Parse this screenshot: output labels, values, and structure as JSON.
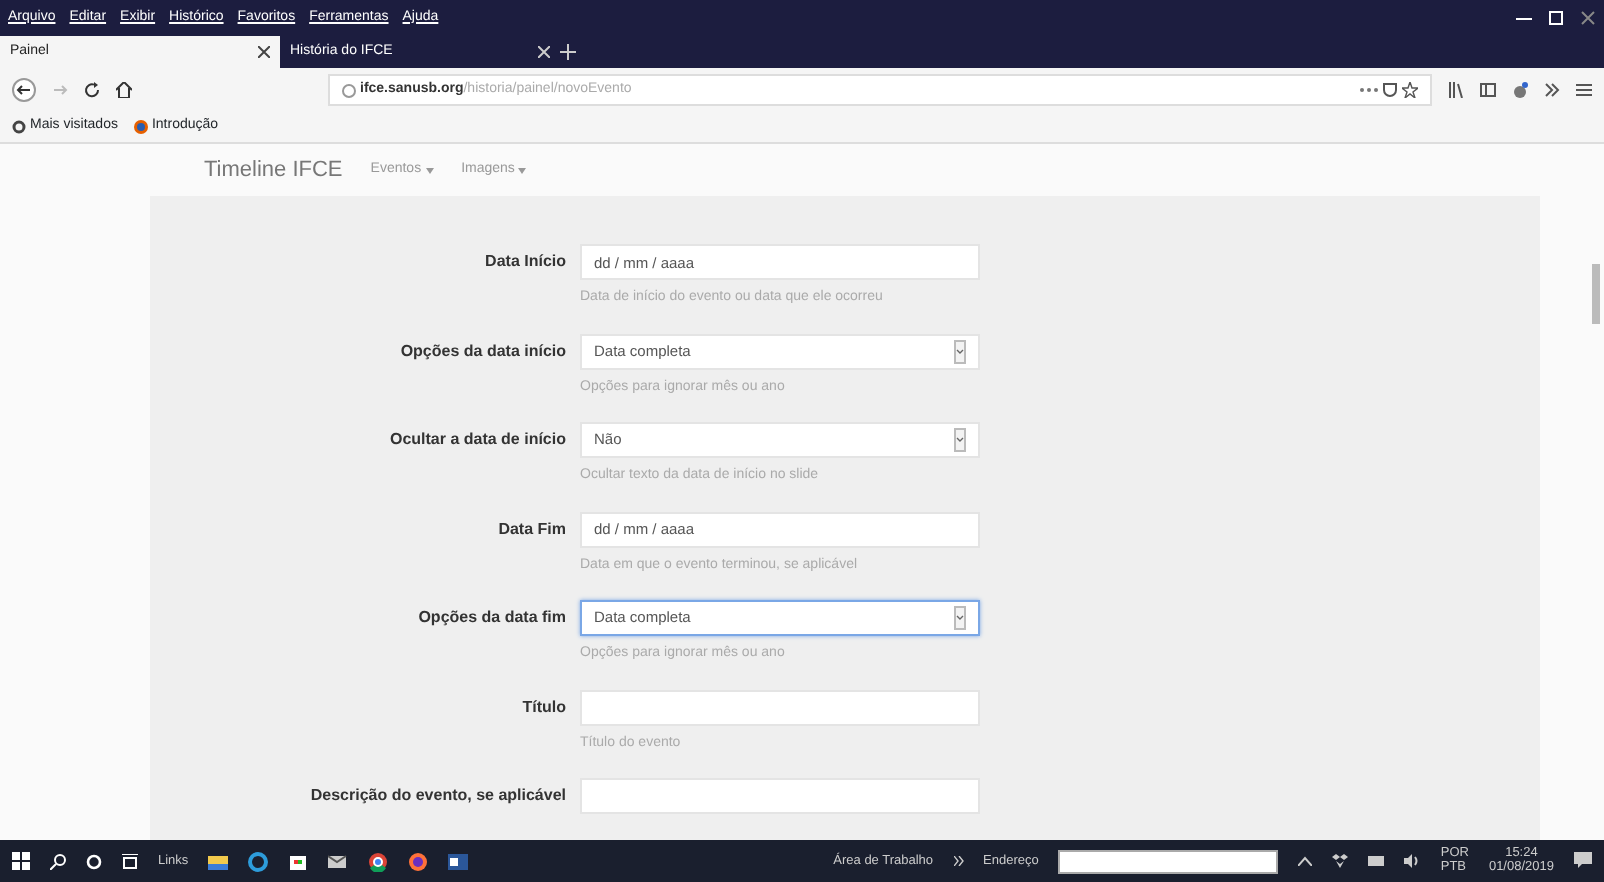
{
  "browser": {
    "menu": [
      "Arquivo",
      "Editar",
      "Exibir",
      "Histórico",
      "Favoritos",
      "Ferramentas",
      "Ajuda"
    ],
    "tabs": [
      {
        "title": "Painel",
        "selected": true
      },
      {
        "title": "História do IFCE",
        "selected": false
      }
    ],
    "address": {
      "domain": "ifce.sanusb.org",
      "path": "/historia/painel/novoEvento"
    },
    "bookmarks": [
      "Mais visitados",
      "Introdução"
    ]
  },
  "site": {
    "brand": "Timeline IFCE",
    "menus": [
      "Eventos",
      "Imagens"
    ]
  },
  "form": [
    {
      "label": "Data Início",
      "kind": "date",
      "value": "dd / mm / aaaa",
      "help": "Data de início do evento ou data que ele ocorreu",
      "focused": false
    },
    {
      "label": "Opções da data início",
      "kind": "select",
      "value": "Data completa",
      "help": "Opções para ignorar mês ou ano",
      "focused": false
    },
    {
      "label": "Ocultar a data de início",
      "kind": "select",
      "value": "Não",
      "help": "Ocultar texto da data de início no slide",
      "focused": false
    },
    {
      "label": "Data Fim",
      "kind": "date",
      "value": "dd / mm / aaaa",
      "help": "Data em que o evento terminou, se aplicável",
      "focused": false
    },
    {
      "label": "Opções da data fim",
      "kind": "select",
      "value": "Data completa",
      "help": "Opções para ignorar mês ou ano",
      "focused": true
    },
    {
      "label": "Título",
      "kind": "text",
      "help": "Título do evento",
      "focused": false
    },
    {
      "label": "Descrição do evento, se aplicável",
      "kind": "text",
      "focused": false
    }
  ],
  "taskbar": {
    "toolbars": [
      "Links",
      "Área de Trabalho"
    ],
    "address_label": "Endereço",
    "language": [
      "POR",
      "PTB"
    ],
    "time": "15:24",
    "date": "01/08/2019"
  }
}
